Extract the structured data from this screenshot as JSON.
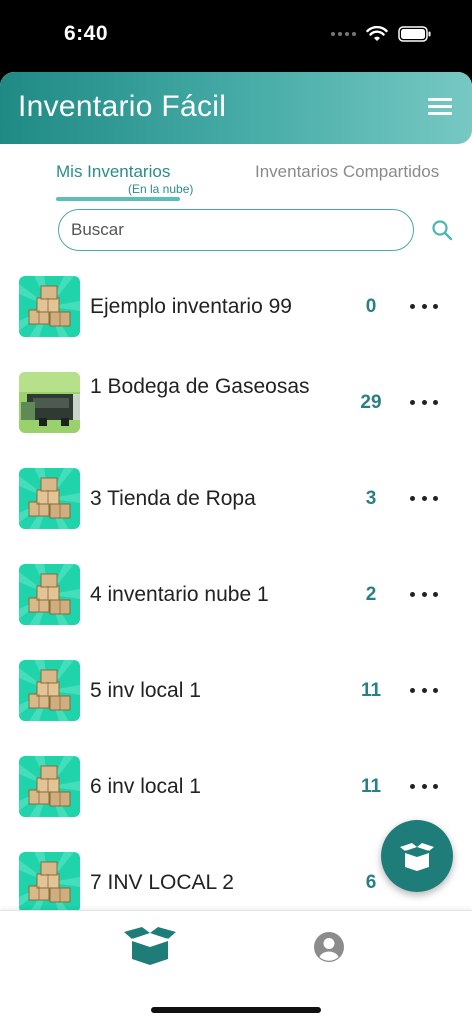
{
  "status": {
    "time": "6:40"
  },
  "app": {
    "title": "Inventario Fácil"
  },
  "tabs": {
    "active": {
      "label": "Mis Inventarios",
      "sublabel": "(En la nube)"
    },
    "inactive": {
      "label": "Inventarios Compartidos"
    }
  },
  "search": {
    "placeholder": "Buscar",
    "value": ""
  },
  "inventories": [
    {
      "name": "Ejemplo inventario 99",
      "count": "0",
      "icon": "boxes-icon"
    },
    {
      "name": "1 Bodega de Gaseosas",
      "count": "29",
      "icon": "truck-image"
    },
    {
      "name": "3 Tienda de Ropa",
      "count": "3",
      "icon": "boxes-icon"
    },
    {
      "name": "4 inventario nube 1",
      "count": "2",
      "icon": "boxes-icon"
    },
    {
      "name": "5 inv local 1",
      "count": "11",
      "icon": "boxes-icon"
    },
    {
      "name": "6 inv local 1",
      "count": "11",
      "icon": "boxes-icon"
    },
    {
      "name": "7 INV LOCAL 2",
      "count": "6",
      "icon": "boxes-icon"
    }
  ],
  "colors": {
    "primary": "#1f8a84",
    "accent": "#2a7f86",
    "header_light": "#77c8c3",
    "thumb_bg": "#1fd3ab"
  },
  "icons": {
    "menu": "hamburger-icon",
    "search": "search-icon",
    "more": "more-horizontal-icon",
    "fab": "open-box-icon",
    "nav_inventory": "open-box-icon",
    "nav_profile": "user-circle-icon"
  }
}
